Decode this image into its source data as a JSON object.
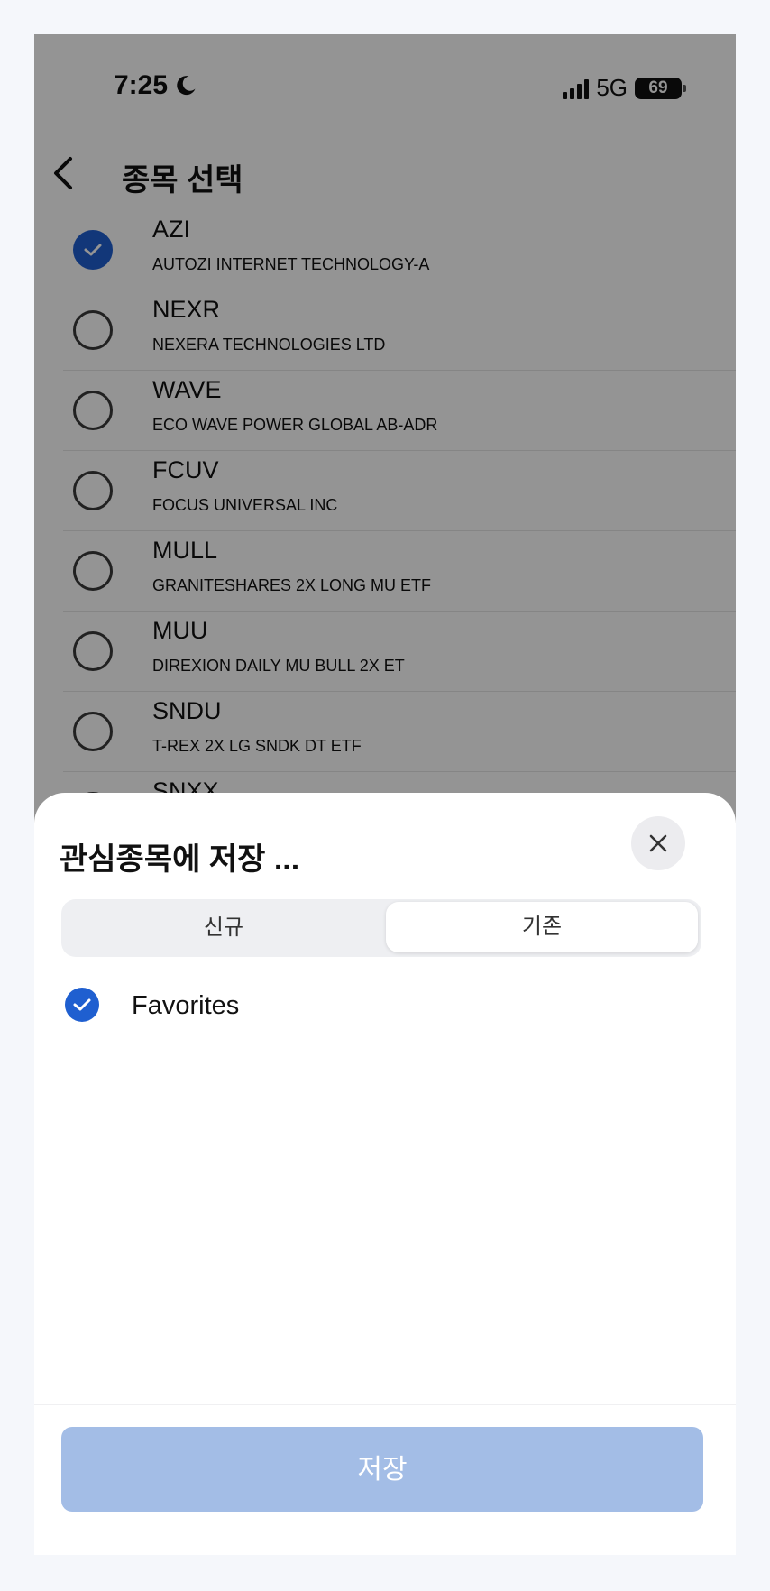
{
  "status": {
    "time": "7:25",
    "network": "5G",
    "battery": "69"
  },
  "header": {
    "title": "종목 선택"
  },
  "stocks": [
    {
      "ticker": "AZI",
      "name": "AUTOZI INTERNET TECHNOLOGY-A",
      "checked": true
    },
    {
      "ticker": "NEXR",
      "name": "NEXERA TECHNOLOGIES LTD",
      "checked": false
    },
    {
      "ticker": "WAVE",
      "name": "ECO WAVE POWER GLOBAL AB-ADR",
      "checked": false
    },
    {
      "ticker": "FCUV",
      "name": "FOCUS UNIVERSAL INC",
      "checked": false
    },
    {
      "ticker": "MULL",
      "name": "GRANITESHARES 2X LONG MU ETF",
      "checked": false
    },
    {
      "ticker": "MUU",
      "name": "DIREXION DAILY MU BULL 2X ET",
      "checked": false
    },
    {
      "ticker": "SNDU",
      "name": "T-REX 2X LG SNDK DT ETF",
      "checked": false
    },
    {
      "ticker": "SNXX",
      "name": "",
      "checked": false
    }
  ],
  "sheet": {
    "title": "관심종목에 저장 ...",
    "tabs": {
      "new": "신규",
      "existing": "기존",
      "selected": "existing"
    },
    "watchlists": [
      {
        "label": "Favorites",
        "checked": true
      }
    ],
    "save_label": "저장"
  },
  "colors": {
    "accent": "#1f5fd0",
    "save_disabled": "#a3bde6",
    "scrim": "rgba(0,0,0,0.42)"
  },
  "icons": [
    "moon-icon",
    "signal-icon",
    "battery-icon",
    "back-icon",
    "check-icon",
    "close-icon"
  ]
}
